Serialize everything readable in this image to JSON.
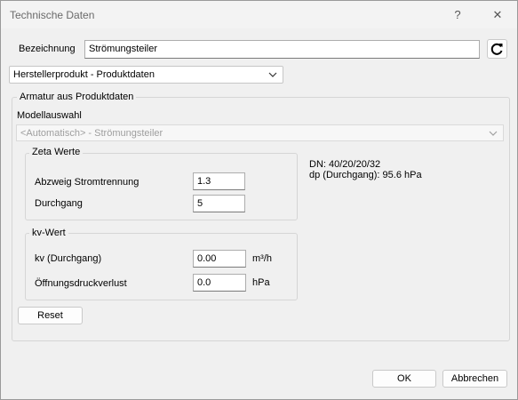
{
  "window": {
    "title": "Technische Daten",
    "help_glyph": "?",
    "close_glyph": "✕"
  },
  "designation": {
    "label": "Bezeichnung",
    "value": "Strömungsteiler"
  },
  "product_source": {
    "selected": "Herstellerprodukt - Produktdaten"
  },
  "armature_group": {
    "title": "Armatur aus Produktdaten",
    "model_label": "Modellauswahl",
    "model_selected": "<Automatisch> - Strömungsteiler"
  },
  "zeta_group": {
    "title": "Zeta Werte",
    "branch_label": "Abzweig Stromtrennung",
    "branch_value": "1.3",
    "through_label": "Durchgang",
    "through_value": "5"
  },
  "info": {
    "dn": "DN: 40/20/20/32",
    "dp": "dp (Durchgang): 95.6 hPa"
  },
  "kv_group": {
    "title": "kv-Wert",
    "kv_label": "kv (Durchgang)",
    "kv_value": "0.00",
    "kv_unit": "m³/h",
    "opening_label": "Öffnungsdruckverlust",
    "opening_value": "0.0",
    "opening_unit": "hPa"
  },
  "buttons": {
    "reset": "Reset",
    "ok": "OK",
    "cancel": "Abbrechen"
  }
}
